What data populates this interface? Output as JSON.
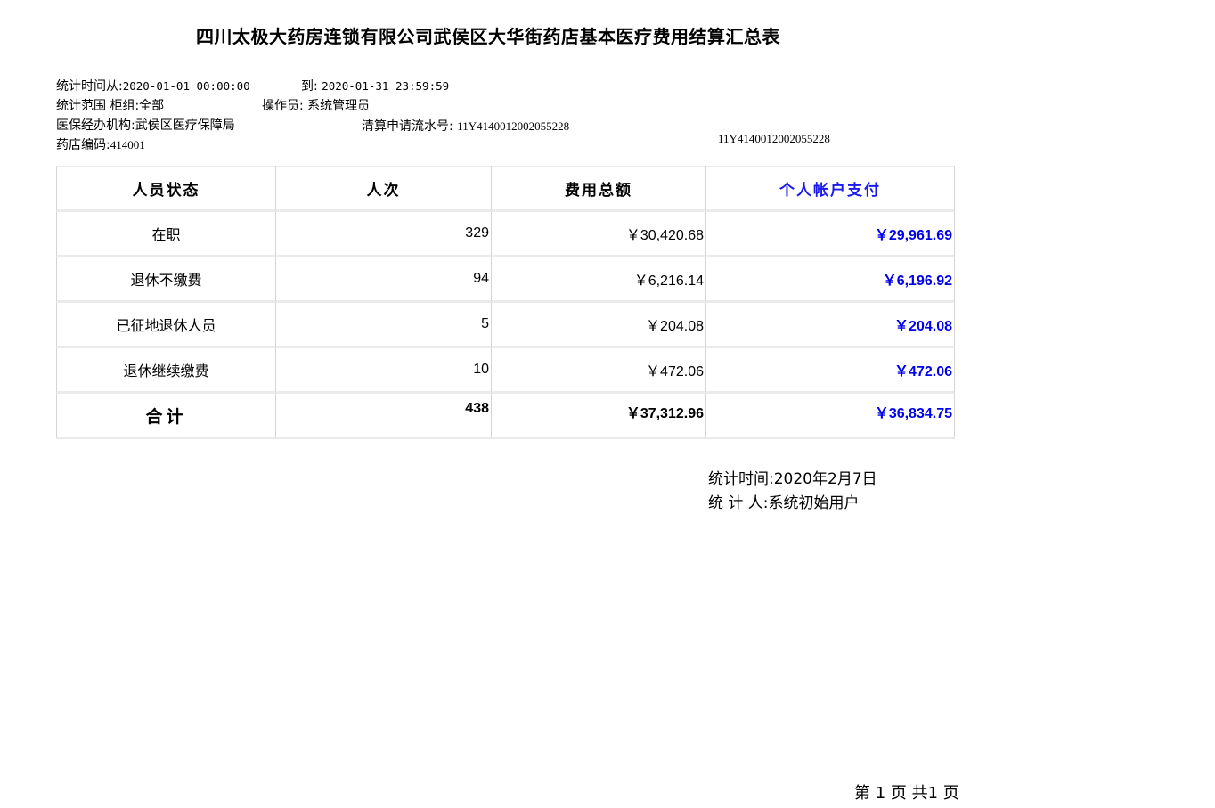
{
  "header": {
    "title": "四川太极大药房连锁有限公司武侯区大华街药店基本医疗费用结算汇总表",
    "stat_time_from_label": "统计时间从:",
    "stat_time_from": "2020-01-01 00:00:00",
    "stat_time_to_label": "到:",
    "stat_time_to": "2020-01-31 23:59:59",
    "scope_label": "统计范围",
    "counter_label": "柜组:",
    "counter_value": "全部",
    "operator_label": "操作员:",
    "operator_value": "系统管理员",
    "agency_label": "医保经办机构:",
    "agency_value": "武侯区医疗保障局",
    "serial_label": "清算申请流水号:",
    "serial_value": "11Y4140012002055228",
    "serial_value_right": "11Y4140012002055228",
    "store_code_label": "药店编码:",
    "store_code_value": "414001"
  },
  "table": {
    "columns": [
      "人员状态",
      "人次",
      "费用总额",
      "个人帐户支付"
    ],
    "rows": [
      {
        "status": "在职",
        "count": "329",
        "total": "￥30,420.68",
        "personal": "￥29,961.69"
      },
      {
        "status": "退休不缴费",
        "count": "94",
        "total": "￥6,216.14",
        "personal": "￥6,196.92"
      },
      {
        "status": "已征地退休人员",
        "count": "5",
        "total": "￥204.08",
        "personal": "￥204.08"
      },
      {
        "status": "退休继续缴费",
        "count": "10",
        "total": "￥472.06",
        "personal": "￥472.06"
      }
    ],
    "total": {
      "status": "合计",
      "count": "438",
      "total": "￥37,312.96",
      "personal": "￥36,834.75"
    }
  },
  "footer": {
    "stat_time_label": "统计时间:",
    "stat_time_value": "2020年2月7日",
    "stat_person_label": "统 计 人:",
    "stat_person_value": "系统初始用户"
  },
  "pager": {
    "text": "第 1 页 共1 页"
  }
}
